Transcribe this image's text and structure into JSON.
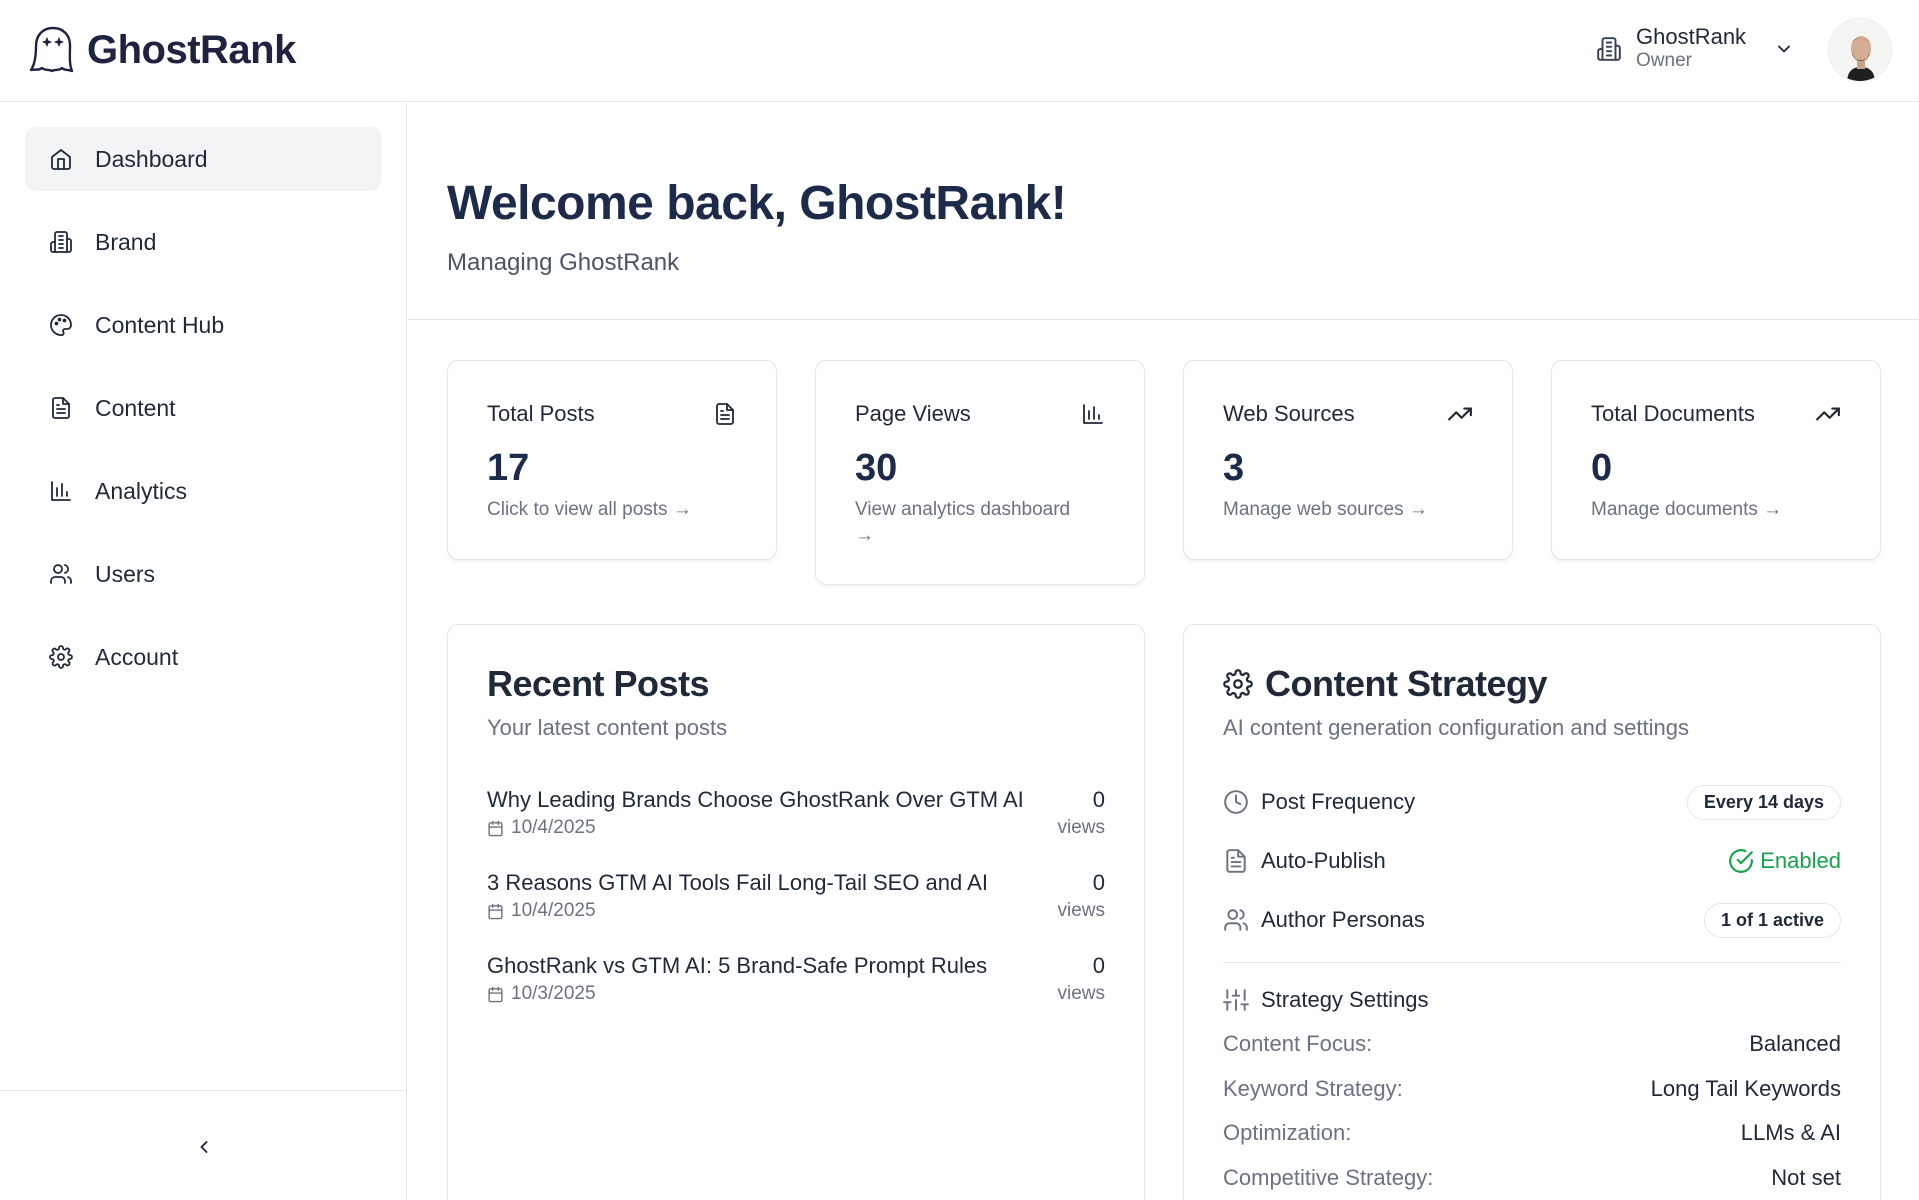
{
  "header": {
    "logo_text": "GhostRank",
    "org_name": "GhostRank",
    "org_role": "Owner"
  },
  "sidebar": {
    "items": [
      {
        "label": "Dashboard",
        "icon": "home-icon",
        "active": true
      },
      {
        "label": "Brand",
        "icon": "building-icon"
      },
      {
        "label": "Content Hub",
        "icon": "palette-icon"
      },
      {
        "label": "Content",
        "icon": "file-text-icon"
      },
      {
        "label": "Analytics",
        "icon": "bar-chart-icon"
      },
      {
        "label": "Users",
        "icon": "users-icon"
      },
      {
        "label": "Account",
        "icon": "gear-icon"
      }
    ]
  },
  "welcome": {
    "title": "Welcome back, GhostRank!",
    "subtitle": "Managing GhostRank"
  },
  "stats": [
    {
      "title": "Total Posts",
      "value": "17",
      "link": "Click to view all posts →",
      "icon": "file-text-icon"
    },
    {
      "title": "Page Views",
      "value": "30",
      "link": "View analytics dashboard →",
      "icon": "bar-chart-icon"
    },
    {
      "title": "Web Sources",
      "value": "3",
      "link": "Manage web sources →",
      "icon": "trending-up-icon"
    },
    {
      "title": "Total Documents",
      "value": "0",
      "link": "Manage documents →",
      "icon": "trending-up-icon"
    }
  ],
  "recent_posts": {
    "title": "Recent Posts",
    "subtitle": "Your latest content posts",
    "views_label": "views",
    "posts": [
      {
        "title": "Why Leading Brands Choose GhostRank Over GTM AI",
        "date": "10/4/2025",
        "views": "0"
      },
      {
        "title": "3 Reasons GTM AI Tools Fail Long-Tail SEO and AI",
        "date": "10/4/2025",
        "views": "0"
      },
      {
        "title": "GhostRank vs GTM AI: 5 Brand-Safe Prompt Rules",
        "date": "10/3/2025",
        "views": "0"
      }
    ]
  },
  "strategy": {
    "title": "Content Strategy",
    "subtitle": "AI content generation configuration and settings",
    "post_frequency_label": "Post Frequency",
    "post_frequency_value": "Every 14 days",
    "auto_publish_label": "Auto-Publish",
    "auto_publish_value": "Enabled",
    "personas_label": "Author Personas",
    "personas_value": "1 of 1 active",
    "settings_title": "Strategy Settings",
    "settings": [
      {
        "label": "Content Focus:",
        "value": "Balanced"
      },
      {
        "label": "Keyword Strategy:",
        "value": "Long Tail Keywords"
      },
      {
        "label": "Optimization:",
        "value": "LLMs & AI"
      },
      {
        "label": "Competitive Strategy:",
        "value": "Not set"
      }
    ]
  },
  "colors": {
    "accent_dark": "#1e2a4a",
    "success": "#16a34a",
    "muted": "#6b7280",
    "border": "#e5e7eb"
  }
}
